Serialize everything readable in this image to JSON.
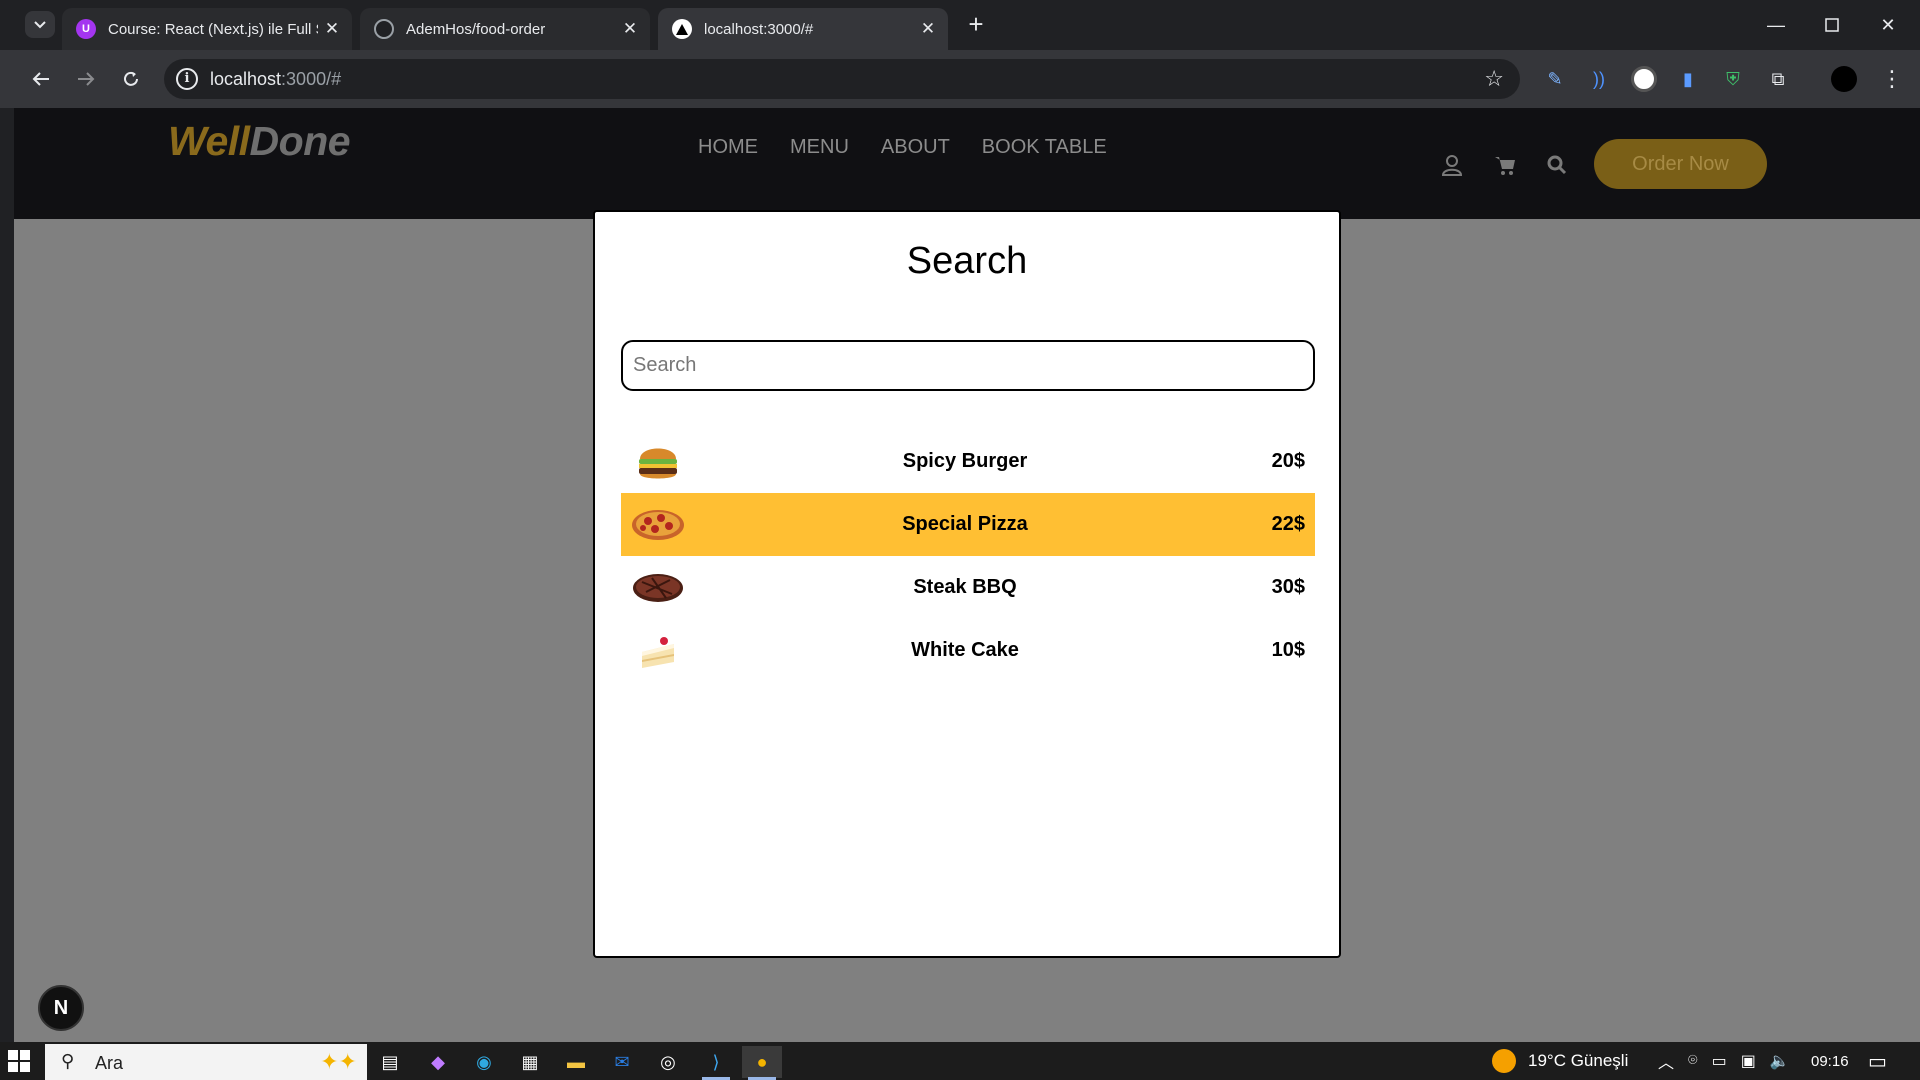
{
  "browser": {
    "tabs": [
      {
        "title": "Course: React (Next.js) ile Full St",
        "favicon": "udemy-icon",
        "active": false
      },
      {
        "title": "AdemHos/food-order",
        "favicon": "github-icon",
        "active": false
      },
      {
        "title": "localhost:3000/#",
        "favicon": "nextjs-icon",
        "active": true
      }
    ],
    "address": {
      "host": "localhost",
      "path": ":3000/#"
    }
  },
  "site": {
    "brand": {
      "part1": "Well",
      "part2": "Done"
    },
    "nav": [
      "HOME",
      "MENU",
      "ABOUT",
      "BOOK TABLE"
    ],
    "order_button": "Order Now",
    "colors": {
      "accent": "#ffbf33",
      "nav_bg": "#101013",
      "overlay": "#808080"
    }
  },
  "modal": {
    "title": "Search",
    "search_placeholder": "Search",
    "search_value": "",
    "results": [
      {
        "name": "Spicy Burger",
        "price": "20$",
        "icon": "burger-icon",
        "highlighted": false
      },
      {
        "name": "Special Pizza",
        "price": "22$",
        "icon": "pizza-icon",
        "highlighted": true
      },
      {
        "name": "Steak BBQ",
        "price": "30$",
        "icon": "steak-icon",
        "highlighted": false
      },
      {
        "name": "White Cake",
        "price": "10$",
        "icon": "cake-icon",
        "highlighted": false
      }
    ]
  },
  "nextjs_badge": "N",
  "taskbar": {
    "search_placeholder": "Ara",
    "weather": "19°C Güneşli",
    "time": "09:16"
  }
}
